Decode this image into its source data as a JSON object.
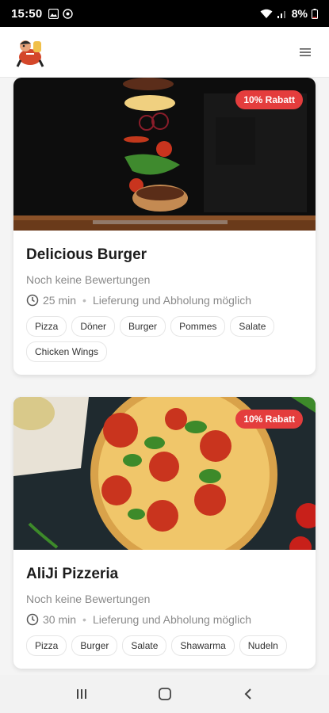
{
  "status": {
    "time": "15:50",
    "battery": "8%"
  },
  "header": {
    "logo_icon": "restaurant-mascot-logo",
    "menu_icon": "hamburger-menu-icon"
  },
  "restaurants": [
    {
      "name": "Delicious Burger",
      "badge": "10% Rabatt",
      "rating": "Noch keine Bewertungen",
      "time": "25 min",
      "delivery": "Lieferung und Abholung möglich",
      "tags": [
        "Pizza",
        "Döner",
        "Burger",
        "Pommes",
        "Salate",
        "Chicken Wings"
      ]
    },
    {
      "name": "AliJi Pizzeria",
      "badge": "10% Rabatt",
      "rating": "Noch keine Bewertungen",
      "time": "30 min",
      "delivery": "Lieferung und Abholung möglich",
      "tags": [
        "Pizza",
        "Burger",
        "Salate",
        "Shawarma",
        "Nudeln"
      ]
    }
  ],
  "colors": {
    "badge": "#e43d3d",
    "statusbar": "#000000"
  }
}
